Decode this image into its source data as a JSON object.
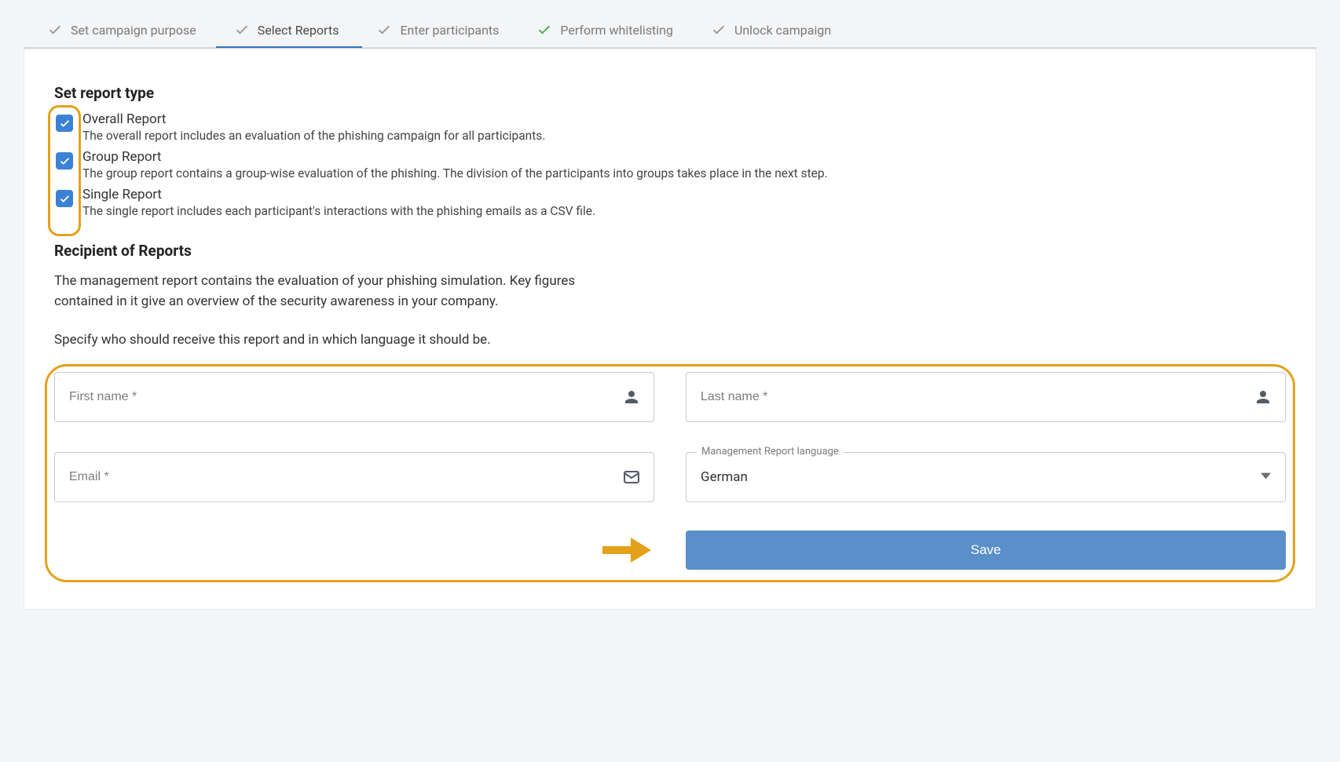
{
  "stepper": {
    "items": [
      {
        "label": "Set campaign purpose",
        "done": true
      },
      {
        "label": "Select Reports",
        "done": true,
        "active": true
      },
      {
        "label": "Enter participants",
        "done": true
      },
      {
        "label": "Perform whitelisting",
        "done": true,
        "green": true
      },
      {
        "label": "Unlock campaign",
        "done": true
      }
    ]
  },
  "reportType": {
    "heading": "Set report type",
    "items": [
      {
        "title": "Overall Report",
        "desc": "The overall report includes an evaluation of the phishing campaign for all participants.",
        "checked": true
      },
      {
        "title": "Group Report",
        "desc": "The group report contains a group-wise evaluation of the phishing. The division of the participants into groups takes place in the next step.",
        "checked": true
      },
      {
        "title": "Single Report",
        "desc": "The single report includes each participant's interactions with the phishing emails as a CSV file.",
        "checked": true
      }
    ]
  },
  "recipient": {
    "heading": "Recipient of Reports",
    "para1": "The management report contains the evaluation of your phishing simulation. Key figures contained in it give an overview of the security awareness in your company.",
    "para2": "Specify who should receive this report and in which language it should be."
  },
  "form": {
    "first_name": {
      "placeholder": "First name *",
      "value": ""
    },
    "last_name": {
      "placeholder": "Last name *",
      "value": ""
    },
    "email": {
      "placeholder": "Email *",
      "value": ""
    },
    "language": {
      "label": "Management Report language",
      "value": "German"
    },
    "save_label": "Save"
  }
}
